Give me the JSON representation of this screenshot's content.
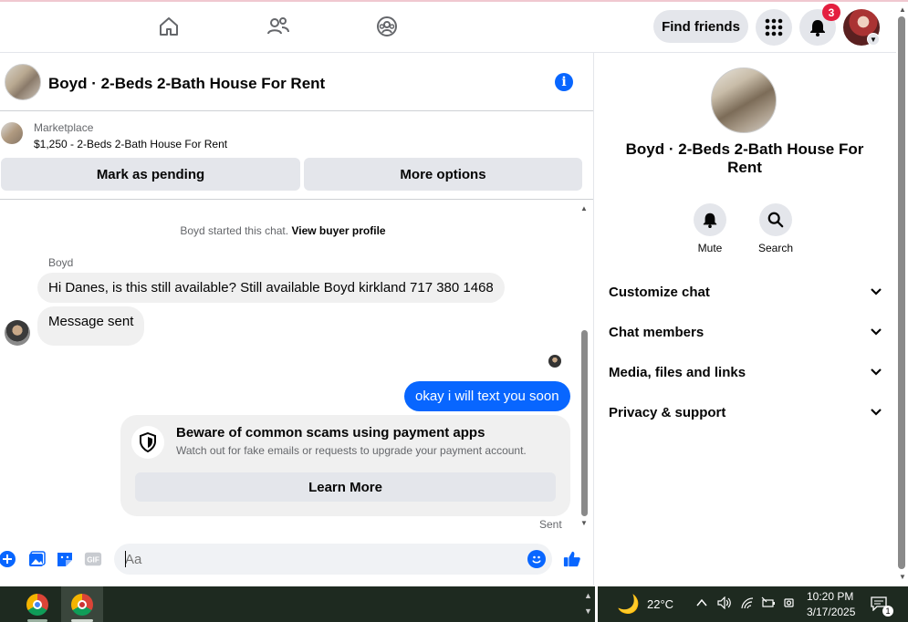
{
  "top_nav": {
    "find_friends_label": "Find friends",
    "notification_count": "3"
  },
  "chat_header": {
    "title": "Boyd · 2-Beds 2-Bath House For Rent"
  },
  "marketplace": {
    "label": "Marketplace",
    "listing": "$1,250 - 2-Beds 2-Bath House For Rent",
    "mark_pending_label": "Mark as pending",
    "more_options_label": "More options"
  },
  "chat": {
    "system_message_prefix": "Boyd started this chat.",
    "system_message_link": "View buyer profile",
    "sender_name": "Boyd",
    "messages": [
      {
        "text": "Hi Danes, is this still available? Still available Boyd kirkland 717 380 1468",
        "direction": "incoming"
      },
      {
        "text": "Message sent",
        "direction": "incoming"
      },
      {
        "text": "okay i will text you soon",
        "direction": "outgoing"
      }
    ],
    "scam_card": {
      "title": "Beware of common scams using payment apps",
      "subtitle": "Watch out for fake emails or requests to upgrade your payment account.",
      "button_label": "Learn More"
    },
    "status": "Sent"
  },
  "composer": {
    "placeholder": "Aa",
    "gif_label": "GIF"
  },
  "side_panel": {
    "name": "Boyd · 2-Beds 2-Bath House For Rent",
    "actions": [
      {
        "label": "Mute",
        "icon": "bell-icon"
      },
      {
        "label": "Search",
        "icon": "search-icon"
      }
    ],
    "sections": [
      {
        "label": "Customize chat"
      },
      {
        "label": "Chat members"
      },
      {
        "label": "Media, files and links"
      },
      {
        "label": "Privacy & support"
      }
    ]
  },
  "taskbar": {
    "temperature": "22°C",
    "time": "10:20 PM",
    "date": "3/17/2025",
    "notification_count": "1"
  },
  "colors": {
    "accent": "#0866ff",
    "badge": "#e41e3f",
    "button_gray": "#e4e6eb",
    "bubble_gray": "#f0f0f0",
    "taskbar": "#1e2a20"
  }
}
